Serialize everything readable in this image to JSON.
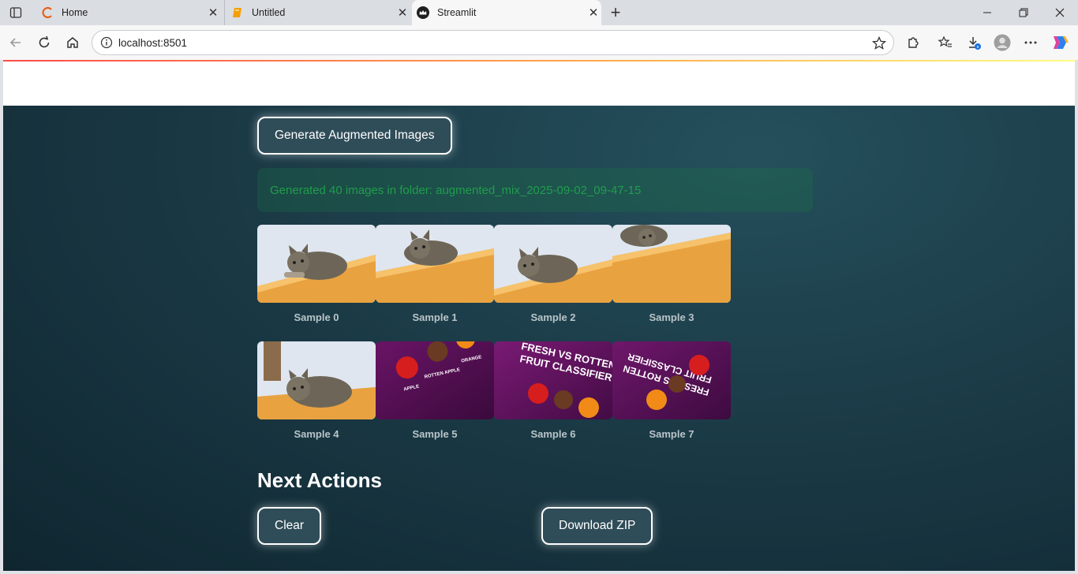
{
  "browser": {
    "tabs": [
      {
        "title": "Home",
        "active": false
      },
      {
        "title": "Untitled",
        "active": false
      },
      {
        "title": "Streamlit",
        "active": true
      }
    ],
    "url": "localhost:8501"
  },
  "app": {
    "generate_button": "Generate Augmented Images",
    "success_message": "Generated 40 images in folder: augmented_mix_2025-09-02_09-47-15",
    "samples": [
      {
        "caption": "Sample 0",
        "kind": "cat-photo"
      },
      {
        "caption": "Sample 1",
        "kind": "cat-photo"
      },
      {
        "caption": "Sample 2",
        "kind": "cat-photo"
      },
      {
        "caption": "Sample 3",
        "kind": "cat-photo"
      },
      {
        "caption": "Sample 4",
        "kind": "cat-photo"
      },
      {
        "caption": "Sample 5",
        "kind": "fruit-poster"
      },
      {
        "caption": "Sample 6",
        "kind": "fruit-poster"
      },
      {
        "caption": "Sample 7",
        "kind": "fruit-poster"
      }
    ],
    "fruit_poster": {
      "headline_1": "FRESH VS ROTTEN",
      "headline_2": "FRUIT CLASSIFIER",
      "label_apple": "APPLE",
      "label_rotten": "ROTTEN APPLE",
      "label_orange": "ORANGE"
    },
    "next_actions": {
      "title": "Next Actions",
      "clear_button": "Clear",
      "download_button": "Download ZIP"
    }
  },
  "colors": {
    "accent_gradient": [
      "#ff4b4b",
      "#ffb14b",
      "#fffd80"
    ],
    "app_background": "#1b3b47",
    "success_text": "#1f9d4c"
  }
}
